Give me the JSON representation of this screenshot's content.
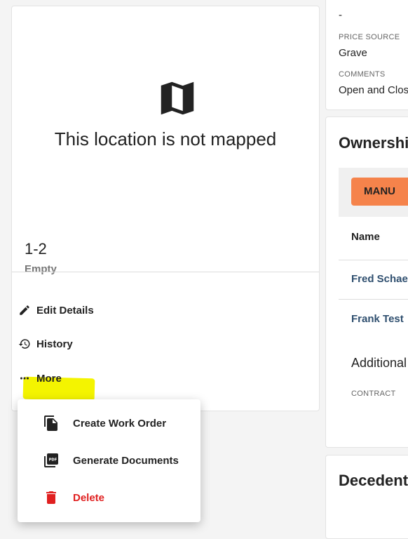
{
  "left_panel": {
    "not_mapped_text": "This location is not mapped",
    "location_id": "1-2",
    "status": "Empty",
    "actions": {
      "edit": "Edit Details",
      "history": "History",
      "more": "More"
    }
  },
  "more_menu": {
    "items": [
      {
        "label": "Create Work Order",
        "icon": "file-copy-icon"
      },
      {
        "label": "Generate Documents",
        "icon": "pdf-icon"
      },
      {
        "label": "Delete",
        "icon": "trash-icon",
        "color": "#e02020"
      }
    ]
  },
  "details_panel": {
    "top_value": "-",
    "price_source_label": "PRICE SOURCE",
    "price_source_value": "Grave",
    "comments_label": "COMMENTS",
    "comments_value": "Open and Clos"
  },
  "ownership_panel": {
    "title": "Ownershi",
    "button_label": "MANU",
    "column_name": "Name",
    "owners": [
      "Fred Schaet",
      "Frank Test"
    ],
    "subsection_title": "Additional",
    "contract_label": "CONTRACT"
  },
  "decedent_panel": {
    "title": "Decedent"
  },
  "colors": {
    "highlight": "#f4f400",
    "accent_button": "#f5834b",
    "danger": "#e02020",
    "link": "#2f4f6f"
  }
}
